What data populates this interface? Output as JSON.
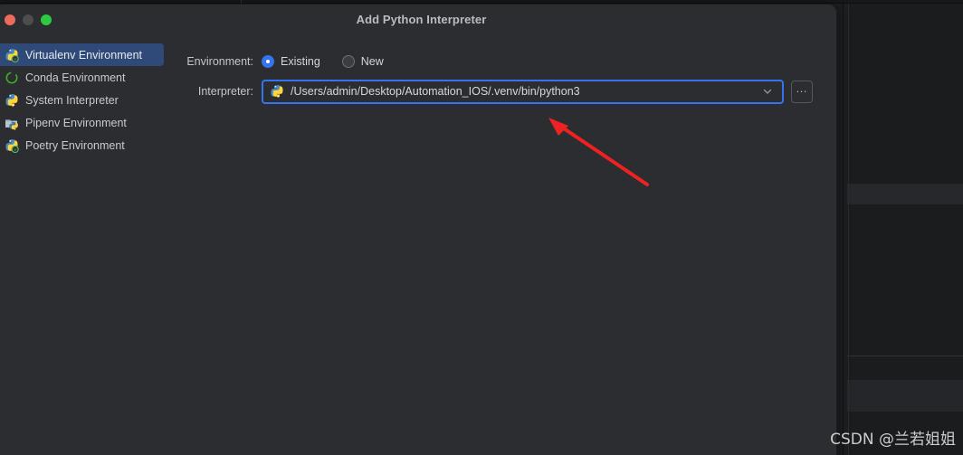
{
  "window": {
    "title": "Add Python Interpreter",
    "controls": {
      "close": "close-window-button",
      "minimize": "minimize-window-button",
      "maximize": "maximize-window-button"
    }
  },
  "sidebar": {
    "items": [
      {
        "label": "Virtualenv Environment",
        "icon": "python-venv-icon",
        "selected": true
      },
      {
        "label": "Conda Environment",
        "icon": "conda-ring-icon",
        "selected": false
      },
      {
        "label": "System Interpreter",
        "icon": "python-icon",
        "selected": false
      },
      {
        "label": "Pipenv Environment",
        "icon": "pipenv-icon",
        "selected": false
      },
      {
        "label": "Poetry Environment",
        "icon": "poetry-icon",
        "selected": false
      }
    ]
  },
  "form": {
    "environment": {
      "label": "Environment:",
      "options": [
        {
          "label": "Existing",
          "selected": true
        },
        {
          "label": "New",
          "selected": false
        }
      ]
    },
    "interpreter": {
      "label": "Interpreter:",
      "value": "/Users/admin/Desktop/Automation_IOS/.venv/bin/python3",
      "icon": "python-icon",
      "dropdown_icon": "chevron-down-icon",
      "browse_label": "…",
      "browse_name": "browse-interpreter-button"
    }
  },
  "annotation": {
    "arrow": "red-arrow-pointing-to-interpreter-field",
    "color": "#ee2222"
  },
  "watermark": {
    "text": "CSDN @兰若姐姐"
  },
  "colors": {
    "accent": "#3574f0",
    "dialog_bg": "#2b2d30",
    "selected_row": "#2f4a79",
    "ide_bg": "#1e1f22"
  }
}
